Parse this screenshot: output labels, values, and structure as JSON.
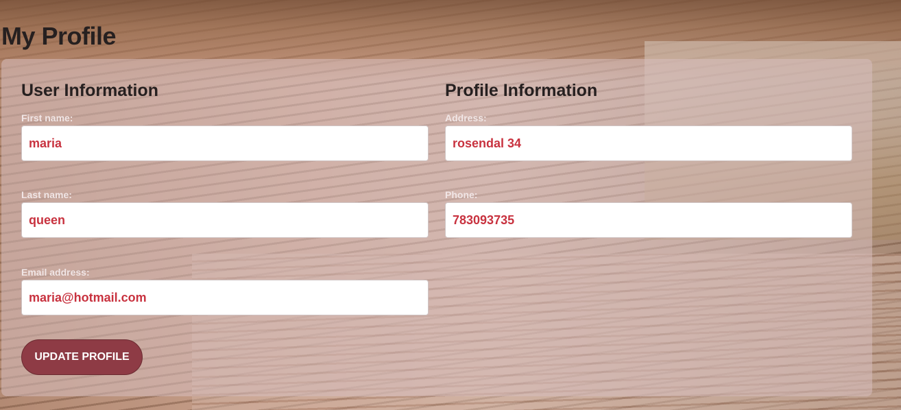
{
  "page": {
    "title": "My Profile"
  },
  "user_info": {
    "heading": "User Information",
    "first_name": {
      "label": "First name:",
      "value": "maria"
    },
    "last_name": {
      "label": "Last name:",
      "value": "queen"
    },
    "email": {
      "label": "Email address:",
      "value": "maria@hotmail.com"
    }
  },
  "profile_info": {
    "heading": "Profile Information",
    "address": {
      "label": "Address:",
      "value": "rosendal 34"
    },
    "phone": {
      "label": "Phone:",
      "value": "783093735"
    }
  },
  "actions": {
    "update_label": "UPDATE PROFILE"
  },
  "colors": {
    "accent": "#8e3b45",
    "input_text": "#c8323f",
    "heading_text": "#262020"
  }
}
